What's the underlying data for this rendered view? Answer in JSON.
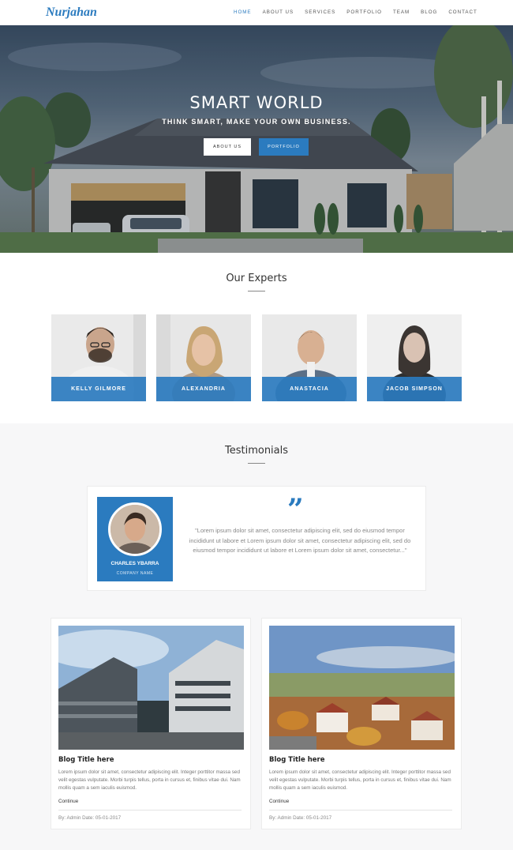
{
  "nav": {
    "logo": "Nurjahan",
    "items": [
      {
        "label": "HOME"
      },
      {
        "label": "ABOUT US"
      },
      {
        "label": "SERVICES"
      },
      {
        "label": "PORTFOLIO"
      },
      {
        "label": "TEAM"
      },
      {
        "label": "BLOG"
      },
      {
        "label": "CONTACT"
      }
    ],
    "active_color": "#2b7bbf"
  },
  "hero": {
    "title": "SMART WORLD",
    "subtitle": "THINK SMART, MAKE YOUR OWN BUSINESS.",
    "btn_about": "ABOUT US",
    "btn_portfolio": "PORTFOLIO"
  },
  "experts": {
    "heading": "Our Experts",
    "members": [
      {
        "name": "KELLY GILMORE"
      },
      {
        "name": "ALEXANDRIA"
      },
      {
        "name": "ANASTACIA"
      },
      {
        "name": "JACOB SIMPSON"
      }
    ]
  },
  "testimonials": {
    "heading": "Testimonials",
    "quote_icon": "quote-icon",
    "name": "CHARLES YBARRA",
    "company": "COMPANY NAME",
    "text": "\"Lorem ipsum dolor sit amet, consectetur adipiscing elit, sed do eiusmod tempor incididunt ut labore et Lorem ipsum dolor sit amet, consectetur adipiscing elit, sed do eiusmod tempor incididunt ut labore et Lorem ipsum dolor sit amet, consectetur...\""
  },
  "blog": {
    "posts": [
      {
        "title": "Blog Title here",
        "excerpt": "Lorem ipsum dolor sit amet, consectetur adipiscing elit. Integer porttitor massa sed velit egestas vulputate. Morbi turpis tellus, porta in cursus et, finibus vitae dui. Nam mollis quam a sem iaculis euismod.",
        "more": "Continue",
        "meta": "By: Admin   Date: 05-01-2017"
      },
      {
        "title": "Blog Title here",
        "excerpt": "Lorem ipsum dolor sit amet, consectetur adipiscing elit. Integer porttitor massa sed velit egestas vulputate. Morbi turpis tellus, porta in cursus et, finibus vitae dui. Nam mollis quam a sem iaculis euismod.",
        "more": "Continue",
        "meta": "By: Admin   Date: 05-01-2017"
      }
    ]
  },
  "colors": {
    "primary": "#2b7bbf",
    "section_bg": "#f7f7f8"
  }
}
